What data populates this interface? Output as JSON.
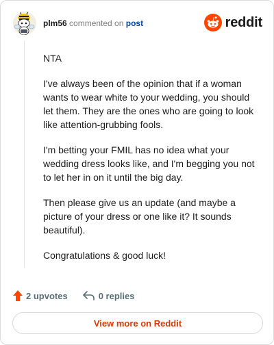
{
  "header": {
    "username": "plm56",
    "verb": "commented on",
    "post_link": "post",
    "brand": "reddit"
  },
  "comment": {
    "paragraphs": [
      "NTA",
      "I've always been of the opinion that if a woman wants to wear white to your wedding, you should let them. They are the ones who are going to look like attention-grubbing fools.",
      "I'm betting your FMIL has no idea what your wedding dress looks like, and I'm begging you not to let her in on it until the big day.",
      "Then please give us an update (and maybe a picture of your dress or one like it? It sounds beautiful).",
      "Congratulations & good luck!"
    ]
  },
  "actions": {
    "upvotes_label": "2 upvotes",
    "replies_label": "0 replies"
  },
  "footer": {
    "view_more_label": "View more on Reddit"
  },
  "colors": {
    "brand_orange": "#ff4500",
    "link_blue": "#0045ac",
    "cta_text": "#d93a00",
    "muted": "#576f76"
  },
  "icons": {
    "avatar": "snoo-avatar-icon",
    "logo": "reddit-snoo-icon",
    "upvote": "upvote-arrow-icon",
    "reply": "reply-arrow-icon"
  }
}
